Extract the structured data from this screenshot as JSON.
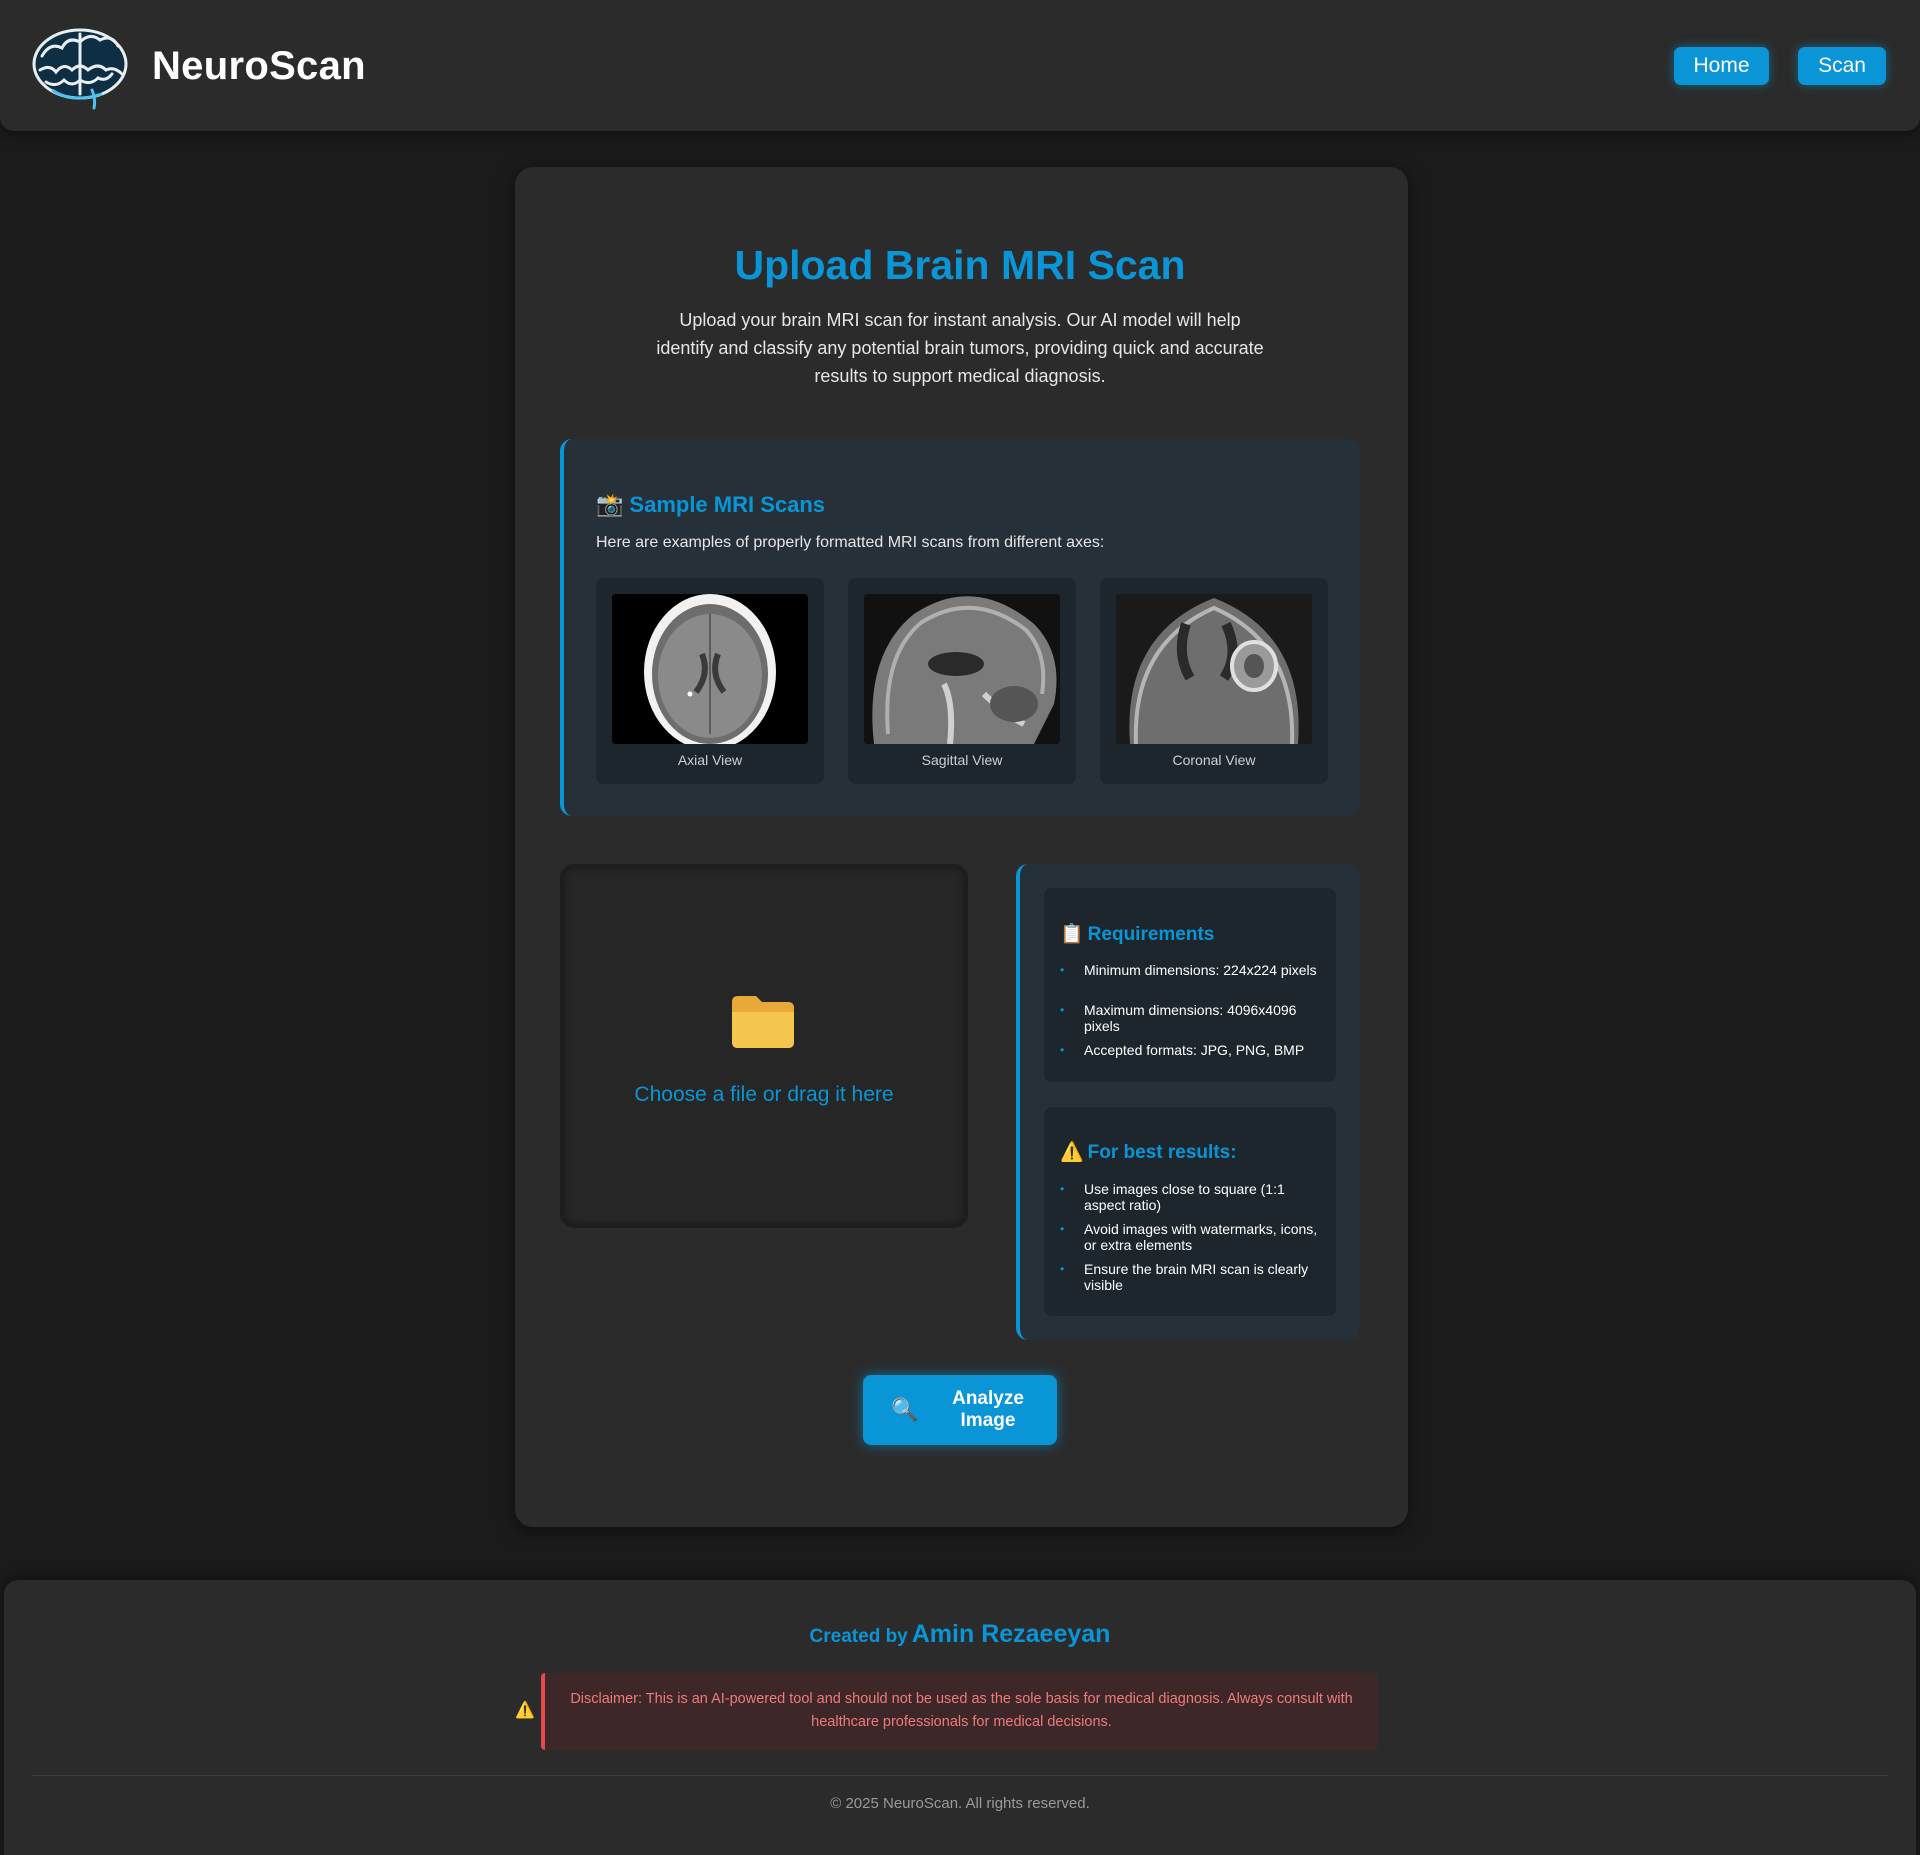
{
  "header": {
    "brand": "NeuroScan",
    "logo_icon": "brain-icon",
    "nav": {
      "home": "Home",
      "scan": "Scan"
    }
  },
  "main": {
    "title": "Upload Brain MRI Scan",
    "intro": "Upload your brain MRI scan for instant analysis. Our AI model will help identify and classify any potential brain tumors, providing quick and accurate results to support medical diagnosis."
  },
  "samples": {
    "icon": "📸",
    "title": "Sample MRI Scans",
    "description": "Here are examples of properly formatted MRI scans from different axes:",
    "items": [
      {
        "caption": "Axial View"
      },
      {
        "caption": "Sagittal View"
      },
      {
        "caption": "Coronal View"
      }
    ]
  },
  "upload": {
    "icon": "folder-icon",
    "text": "Choose a file or drag it here"
  },
  "requirements": {
    "icon": "📋",
    "title": "Requirements",
    "items": [
      "Minimum dimensions: 224x224 pixels",
      "Maximum dimensions: 4096x4096 pixels",
      "Accepted formats: JPG, PNG, BMP"
    ]
  },
  "best_results": {
    "icon": "⚠️",
    "title": "For best results:",
    "items": [
      "Use images close to square (1:1 aspect ratio)",
      "Avoid images with watermarks, icons, or extra elements",
      "Ensure the brain MRI scan is clearly visible"
    ]
  },
  "analyze": {
    "icon": "🔍",
    "label": "Analyze Image"
  },
  "footer": {
    "created_by": "Created by",
    "author": "Amin Rezaeeyan",
    "warning_icon": "⚠️",
    "disclaimer": "Disclaimer: This is an AI-powered tool and should not be used as the sole basis for medical diagnosis. Always consult with healthcare professionals for medical decisions.",
    "copyright": "© 2025 NeuroScan. All rights reserved."
  },
  "colors": {
    "accent": "#0a95d6",
    "background": "#1b1b1b",
    "panel": "#2b2b2b",
    "disclaimer_text": "#f07a7a"
  }
}
